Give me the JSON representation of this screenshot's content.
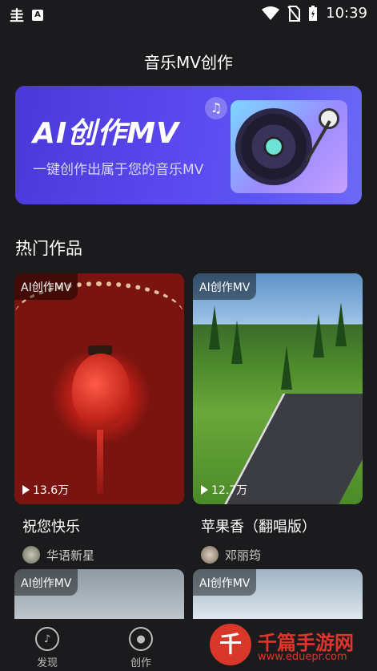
{
  "status_bar": {
    "left_icons": [
      "app-logo",
      "a-icon"
    ],
    "time": "10:39",
    "right_icons": [
      "wifi-icon",
      "no-sim-icon",
      "battery-icon"
    ]
  },
  "header": {
    "title": "音乐MV创作"
  },
  "banner": {
    "title": "AI创作MV",
    "subtitle": "一键创作出属于您的音乐MV"
  },
  "section": {
    "title": "热门作品"
  },
  "cards": [
    {
      "tag": "AI创作MV",
      "plays": "13.6万",
      "title": "祝您快乐",
      "author": "华语新星"
    },
    {
      "tag": "AI创作MV",
      "plays": "12.7万",
      "title": "苹果香（翻唱版）",
      "author": "邓丽筠"
    },
    {
      "tag": "AI创作MV"
    },
    {
      "tag": "AI创作MV"
    }
  ],
  "bottom_nav": [
    {
      "label": "发现",
      "icon": "music-note-icon"
    },
    {
      "label": "创作",
      "icon": "disc-icon"
    }
  ],
  "watermark": {
    "logo_char": "千",
    "name": "千篇手游网",
    "url": "www.eduepr.com"
  }
}
